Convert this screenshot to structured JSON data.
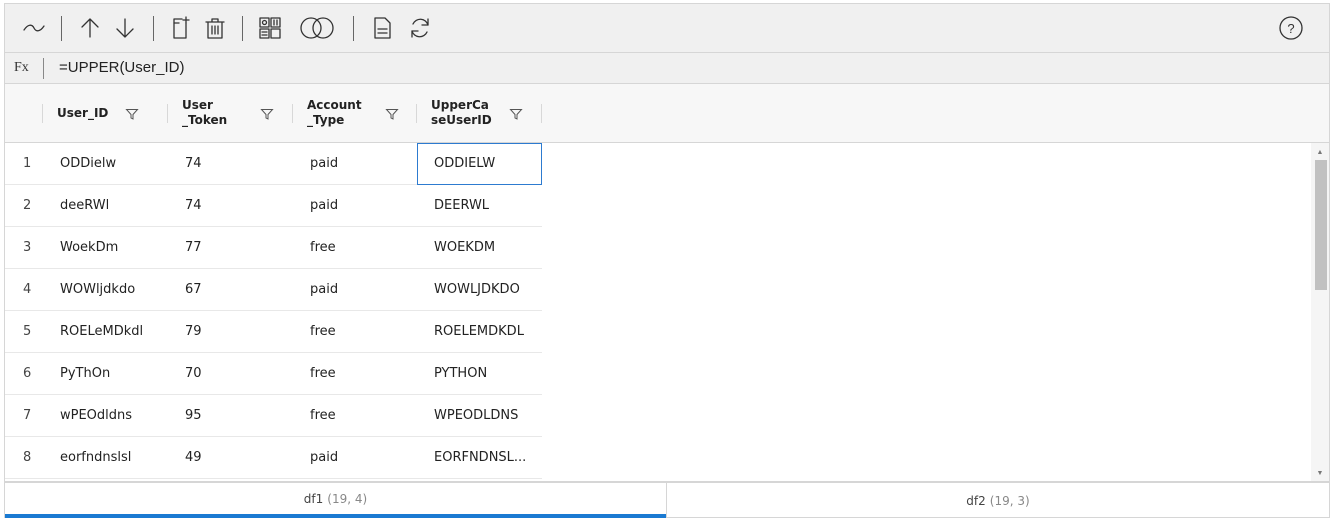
{
  "toolbar": {
    "icons": [
      "wave-icon",
      "arrow-up-icon",
      "arrow-down-icon",
      "add-file-icon",
      "trash-icon",
      "pivot-icon",
      "merge-icon",
      "document-icon",
      "refresh-icon",
      "help-icon"
    ],
    "help_label": "?"
  },
  "formula": {
    "label": "Fx",
    "value": "=UPPER(User_ID)"
  },
  "columns": [
    {
      "label": "User_ID"
    },
    {
      "label": "User\n_Token"
    },
    {
      "label": "Account\n_Type"
    },
    {
      "label": "UpperCa\nseUserID"
    }
  ],
  "rows": [
    {
      "num": "1",
      "user_id": "ODDielw",
      "token": "74",
      "type": "paid",
      "upper": "ODDIELW"
    },
    {
      "num": "2",
      "user_id": "deeRWl",
      "token": "74",
      "type": "paid",
      "upper": "DEERWL"
    },
    {
      "num": "3",
      "user_id": "WoekDm",
      "token": "77",
      "type": "free",
      "upper": "WOEKDM"
    },
    {
      "num": "4",
      "user_id": "WOWljdkdo",
      "token": "67",
      "type": "paid",
      "upper": "WOWLJDKDO"
    },
    {
      "num": "5",
      "user_id": "ROELeMDkdl",
      "token": "79",
      "type": "free",
      "upper": "ROELEMDKDL"
    },
    {
      "num": "6",
      "user_id": "PyThOn",
      "token": "70",
      "type": "free",
      "upper": "PYTHON"
    },
    {
      "num": "7",
      "user_id": "wPEOdldns",
      "token": "95",
      "type": "free",
      "upper": "WPEODLDNS"
    },
    {
      "num": "8",
      "user_id": "eorfndnslsl",
      "token": "49",
      "type": "paid",
      "upper": "EORFNDNSL..."
    }
  ],
  "tabs": [
    {
      "name": "df1",
      "shape": "(19, 4)",
      "active": true
    },
    {
      "name": "df2",
      "shape": "(19, 3)",
      "active": false
    }
  ],
  "colors": {
    "accent": "#1a7ad2",
    "selection": "#2d7bd0",
    "toolbar_bg": "#f0f0f0"
  }
}
